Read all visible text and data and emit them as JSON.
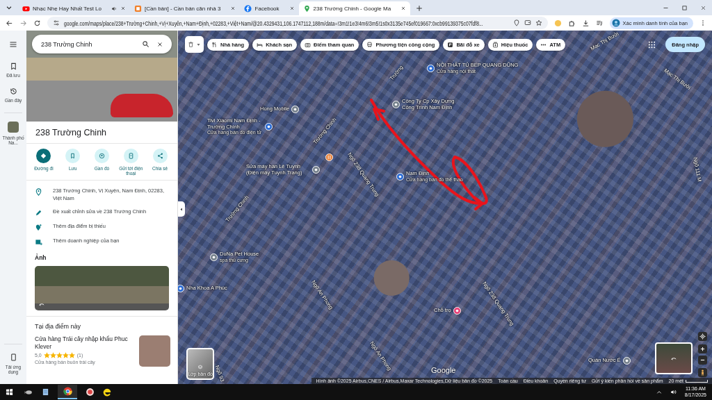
{
  "browser": {
    "tabs": [
      {
        "title": "Nhạc Nhẹ Hay Nhất Test Lo",
        "selected": false
      },
      {
        "title": "[Cần bán] - Cần bán căn nhà 3",
        "selected": false
      },
      {
        "title": "Facebook",
        "selected": false
      },
      {
        "title": "238 Trường Chinh - Google Ma",
        "selected": true
      }
    ],
    "address": "google.com/maps/place/238+Trường+Chinh,+Vị+Xuyên,+Nam+Định,+02283,+Việt+Nam/@20.4329431,106.1747112,188m/data=!3m1!1e3!4m6!3m5!1s0x3135e745ef019667:0xcb99139375c07fdf8...",
    "profile_chip": "Xác minh danh tính của bạn"
  },
  "rail": {
    "items": [
      {
        "label": "Đã lưu"
      },
      {
        "label": "Gần đây"
      },
      {
        "label": "Thành phố Na..."
      }
    ],
    "get_app": "Tải ứng dụng"
  },
  "panel": {
    "search": {
      "value": "238 Trường Chinh"
    },
    "title": "238 Trường Chinh",
    "actions": [
      {
        "label": "Đường đi",
        "primary": true
      },
      {
        "label": "Lưu",
        "primary": false
      },
      {
        "label": "Gần đó",
        "primary": false
      },
      {
        "label": "Gửi tới điện thoại",
        "primary": false
      },
      {
        "label": "Chia sẻ",
        "primary": false
      }
    ],
    "details": [
      {
        "text": "238 Trường Chinh, Vị Xuyên, Nam Định, 02283, Việt Nam"
      },
      {
        "text": "Đề xuất chỉnh sửa về 238 Trường Chinh"
      },
      {
        "text": "Thêm địa điểm bị thiếu"
      },
      {
        "text": "Thêm doanh nghiệp của bạn"
      }
    ],
    "photos_heading": "Ảnh",
    "nearby_heading": "Tại địa điểm này",
    "place": {
      "name": "Cửa hàng Trái cây nhập khẩu Phuc Klever",
      "rating": "5,0",
      "stars": 5,
      "review_count": "(1)",
      "category": "Cửa hàng bán buôn trái cây"
    }
  },
  "map": {
    "chips": [
      {
        "label": "Nhà hàng"
      },
      {
        "label": "Khách sạn"
      },
      {
        "label": "Điểm tham quan"
      },
      {
        "label": "Phương tiện công cộng"
      },
      {
        "label": "Bãi đỗ xe"
      },
      {
        "label": "Hiệu thuốc"
      },
      {
        "label": "ATM"
      }
    ],
    "sign_in": "Đăng nhập",
    "streets": [
      {
        "name": "Trường"
      },
      {
        "name": "Mạc Thị Bưởi"
      },
      {
        "name": "Mạc Thị Bưởi"
      },
      {
        "name": "Trường Chinh"
      },
      {
        "name": "Ngõ 238 Quang Trung"
      },
      {
        "name": "Trường Chinh"
      },
      {
        "name": "Ngõ 111 M"
      },
      {
        "name": "Ngõ An Phong"
      },
      {
        "name": "Ngõ 238 Quang Trung"
      },
      {
        "name": "Ngõ An Phong"
      },
      {
        "name": "Ngõ 93"
      }
    ],
    "places": [
      {
        "name": "NỘI THẤT TỦ BẾP QUANG DŨNG",
        "subtitle": "Cửa hàng nội thất"
      },
      {
        "name": "Hùng Mobile"
      },
      {
        "name": "Công Ty Cp Xây Dựng Công Trình Nam Định"
      },
      {
        "name": "Tivi Xiaomi Nam Định - Trường Chinh",
        "subtitle": "Cửa hàng bán đồ điện tử"
      },
      {
        "name": "Sửa máy hàn Lê Tuynh (Điện máy Tuynh Trang)"
      },
      {
        "name": "Nam Định",
        "subtitle": "Cửa hàng bán đồ thể thao"
      },
      {
        "name": "DuNa Pet House",
        "subtitle": "spa thú cưng"
      },
      {
        "name": "Nha Khoa A Phúc"
      },
      {
        "name": "Chỗ trọ"
      },
      {
        "name": "Quán Nước É"
      }
    ],
    "layers_label": "Lớp bản đồ",
    "logo": "Google",
    "attribution": [
      {
        "text": "Hình ảnh ©2025 Airbus,CNES / Airbus,Maxar Technologies,Dữ liệu bản đồ ©2025"
      },
      {
        "text": "Toàn cầu"
      },
      {
        "text": "Điều khoản"
      },
      {
        "text": "Quyền riêng tư"
      },
      {
        "text": "Gửi ý kiến phản hồi về sản phẩm"
      }
    ],
    "scale": "20 mét"
  },
  "taskbar": {
    "time": "11:36 AM",
    "date": "8/17/2025"
  }
}
